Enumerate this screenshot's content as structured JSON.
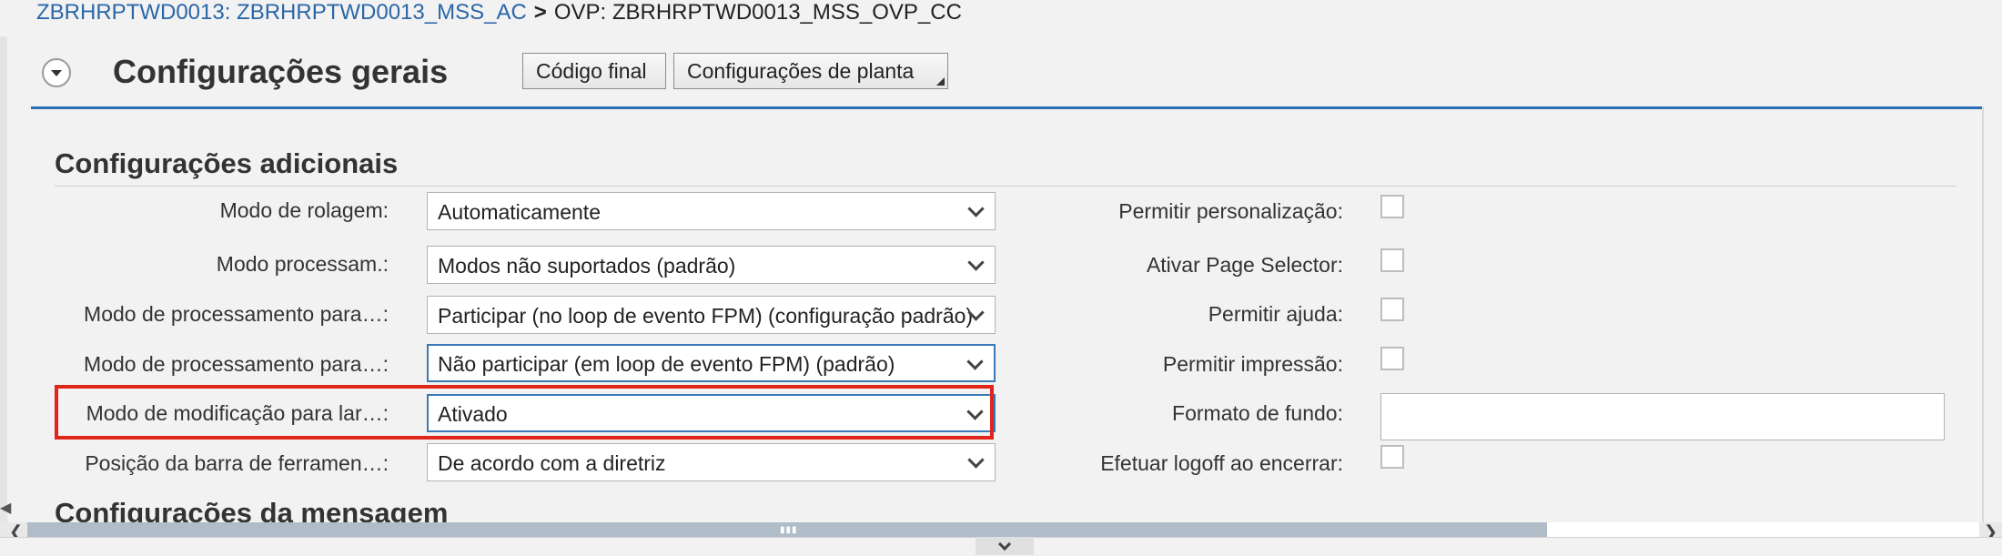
{
  "breadcrumb": {
    "link": "ZBRHRPTWD0013: ZBRHRPTWD0013_MSS_AC",
    "separator": ">",
    "current": "OVP: ZBRHRPTWD0013_MSS_OVP_CC"
  },
  "header": {
    "title": "Configurações gerais",
    "buttons": {
      "codigo_final": "Código final",
      "config_planta": "Configurações de planta"
    }
  },
  "sections": {
    "adicionais": "Configurações adicionais",
    "mensagem": "Configurações da mensagem"
  },
  "left_fields": [
    {
      "label": "Modo de rolagem:",
      "value": "Automaticamente"
    },
    {
      "label": "Modo processam.:",
      "value": "Modos não suportados (padrão)"
    },
    {
      "label": "Modo de processamento para…:",
      "value": "Participar (no loop de evento FPM) (configuração padrão)"
    },
    {
      "label": "Modo de processamento para…:",
      "value": "Não participar (em loop de evento FPM) (padrão)"
    },
    {
      "label": "Modo de modificação para lar…:",
      "value": "Ativado"
    },
    {
      "label": "Posição da barra de ferramen…:",
      "value": "De acordo com a diretriz"
    }
  ],
  "right_fields": [
    {
      "label": "Permitir personalização:",
      "checked": false
    },
    {
      "label": "Ativar Page Selector:",
      "checked": false
    },
    {
      "label": "Permitir ajuda:",
      "checked": false
    },
    {
      "label": "Permitir impressão:",
      "checked": false
    },
    {
      "label": "Formato de fundo:",
      "value": ""
    },
    {
      "label": "Efetuar logoff ao encerrar:",
      "checked": false
    }
  ],
  "colors": {
    "accent": "#2b6fb6",
    "link": "#2b66a8",
    "highlight": "#e0251b"
  }
}
